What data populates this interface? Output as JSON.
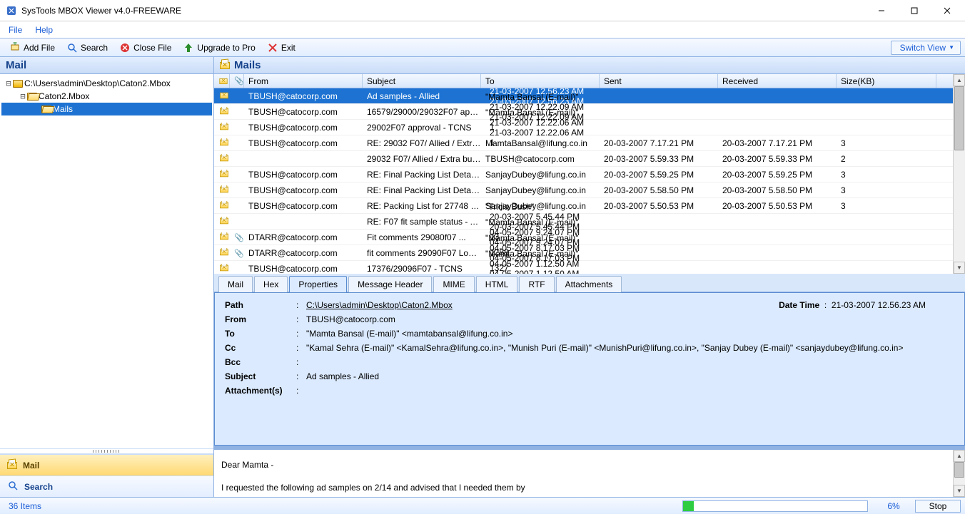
{
  "window": {
    "title": "SysTools MBOX Viewer v4.0-FREEWARE"
  },
  "menubar": {
    "file": "File",
    "help": "Help"
  },
  "toolbar": {
    "add_file": "Add File",
    "search": "Search",
    "close_file": "Close File",
    "upgrade": "Upgrade to Pro",
    "exit": "Exit",
    "switch_view": "Switch View"
  },
  "sidebar": {
    "header": "Mail",
    "tree": {
      "root": "C:\\Users\\admin\\Desktop\\Caton2.Mbox",
      "child": "Caton2.Mbox",
      "leaf": "Mails"
    },
    "btn_mail": "Mail",
    "btn_search": "Search"
  },
  "mails": {
    "header": "Mails",
    "columns": {
      "from": "From",
      "subject": "Subject",
      "to": "To",
      "sent": "Sent",
      "received": "Received",
      "size": "Size(KB)"
    },
    "rows": [
      {
        "from": "TBUSH@catocorp.com",
        "subject": "Ad samples - Allied",
        "to": "\"Mamta Bansal (E-mail)\" <m...",
        "sent": "21-03-2007 12.56.23 AM",
        "recv": "21-03-2007 12.56.23 AM",
        "size": "1",
        "att": false,
        "selected": true
      },
      {
        "from": "TBUSH@catocorp.com",
        "subject": "16579/29000/29032F07 appr...",
        "to": "\"Mamta Bansal (E-mail)\" <ma...",
        "sent": "21-03-2007 12.22.09 AM",
        "recv": "21-03-2007 12.22.09 AM",
        "size": "1",
        "att": false
      },
      {
        "from": "TBUSH@catocorp.com",
        "subject": "29002F07 approval - TCNS",
        "to": "\"Mamta Bansal (E-mail)\" <ma...",
        "sent": "21-03-2007 12.22.06 AM",
        "recv": "21-03-2007 12.22.06 AM",
        "size": "1",
        "att": false
      },
      {
        "from": "TBUSH@catocorp.com",
        "subject": "RE: 29032 F07/ Allied / Extra ...",
        "to": "MamtaBansal@lifung.co.in",
        "sent": "20-03-2007 7.17.21 PM",
        "recv": "20-03-2007 7.17.21 PM",
        "size": "3",
        "att": false
      },
      {
        "from": "",
        "subject": "29032 F07/ Allied / Extra butt...",
        "to": "TBUSH@catocorp.com",
        "sent": "20-03-2007 5.59.33 PM",
        "recv": "20-03-2007 5.59.33 PM",
        "size": "2",
        "att": false
      },
      {
        "from": "TBUSH@catocorp.com",
        "subject": "RE: Final Packing List Detail f...",
        "to": "SanjayDubey@lifung.co.in",
        "sent": "20-03-2007 5.59.25 PM",
        "recv": "20-03-2007 5.59.25 PM",
        "size": "3",
        "att": false
      },
      {
        "from": "TBUSH@catocorp.com",
        "subject": "RE: Final Packing List Detail f...",
        "to": "SanjayDubey@lifung.co.in",
        "sent": "20-03-2007 5.58.50 PM",
        "recv": "20-03-2007 5.58.50 PM",
        "size": "3",
        "att": false
      },
      {
        "from": "TBUSH@catocorp.com",
        "subject": "RE: Packing List for 27748 S0...",
        "to": "SanjayDubey@lifung.co.in",
        "sent": "20-03-2007 5.50.53 PM",
        "recv": "20-03-2007 5.50.53 PM",
        "size": "3",
        "att": false
      },
      {
        "from": "",
        "subject": "RE: F07 fit sample status - All...",
        "to": "\"Tricia Bush\" <TBUSH@catoc...",
        "sent": "20-03-2007 5.45.44 PM",
        "recv": "20-03-2007 5.45.44 PM",
        "size": "13",
        "att": false
      },
      {
        "from": "DTARR@catocorp.com",
        "subject": "Fit comments 29080f07   ...",
        "to": "\"Mamta Bansal (E-mail)\" <ma...",
        "sent": "04-05-2007 9.24.07 PM",
        "recv": "04-05-2007 9.24.07 PM",
        "size": "1288",
        "att": true
      },
      {
        "from": "DTARR@catocorp.com",
        "subject": "fit comments 29090F07 Lovec...",
        "to": "\"Mamta Bansal (E-mail)\" <ma...",
        "sent": "04-05-2007 8.17.03 PM",
        "recv": "04-05-2007 8.17.03 PM",
        "size": "1327",
        "att": true
      },
      {
        "from": "TBUSH@catocorp.com",
        "subject": "17376/29096F07 - TCNS",
        "to": "\"Mamta Bansal (E-mail)\" <ma...",
        "sent": "04-05-2007 1.12.50 AM",
        "recv": "04-05-2007 1.12.50 AM",
        "size": "1",
        "att": false
      }
    ]
  },
  "tabs": [
    "Mail",
    "Hex",
    "Properties",
    "Message Header",
    "MIME",
    "HTML",
    "RTF",
    "Attachments"
  ],
  "detail": {
    "labels": {
      "path": "Path",
      "from": "From",
      "to": "To",
      "cc": "Cc",
      "bcc": "Bcc",
      "subject": "Subject",
      "attachments": "Attachment(s)",
      "datetime": "Date Time"
    },
    "path": "C:\\Users\\admin\\Desktop\\Caton2.Mbox",
    "from": "TBUSH@catocorp.com",
    "to": "\"Mamta Bansal (E-mail)\" <mamtabansal@lifung.co.in>",
    "cc": "\"Kamal Sehra (E-mail)\" <KamalSehra@lifung.co.in>, \"Munish Puri (E-mail)\" <MunishPuri@lifung.co.in>, \"Sanjay Dubey (E-mail)\" <sanjaydubey@lifung.co.in>",
    "bcc": "",
    "subject": "Ad samples - Allied",
    "attachments": "",
    "datetime": "21-03-2007 12.56.23 AM"
  },
  "body": {
    "line1": "Dear Mamta -",
    "line2": "I requested the following ad samples on 2/14 and advised that I needed them by"
  },
  "status": {
    "items": "36 Items",
    "percent": "6%",
    "stop": "Stop"
  }
}
